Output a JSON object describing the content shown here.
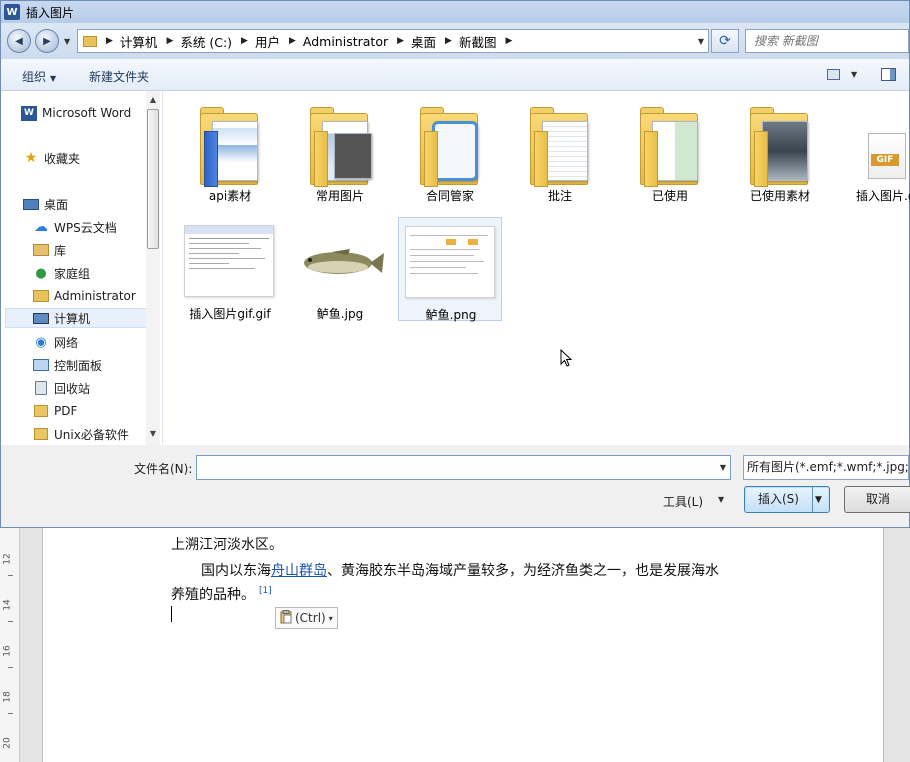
{
  "window": {
    "title": "插入图片",
    "app_icon_text": "W"
  },
  "nav": {
    "back_glyph": "◀",
    "forward_glyph": "▶",
    "breadcrumbs": [
      "计算机",
      "系统 (C:)",
      "用户",
      "Administrator",
      "桌面",
      "新截图"
    ],
    "breadcrumb_separator": "▶",
    "search_placeholder": "搜索 新截图",
    "refresh_glyph": "⟳"
  },
  "toolbar": {
    "organize_label": "组织",
    "new_folder_label": "新建文件夹"
  },
  "sidebar": {
    "items": [
      {
        "label": "Microsoft Word",
        "icon": "word-icon"
      },
      {
        "label": "收藏夹",
        "icon": "star-icon"
      },
      {
        "label": "桌面",
        "icon": "desktop-icon"
      },
      {
        "label": "WPS云文档",
        "icon": "cloud-icon"
      },
      {
        "label": "库",
        "icon": "library-icon"
      },
      {
        "label": "家庭组",
        "icon": "homegroup-icon"
      },
      {
        "label": "Administrator",
        "icon": "user-folder-icon"
      },
      {
        "label": "计算机",
        "icon": "computer-icon",
        "selected": true
      },
      {
        "label": "网络",
        "icon": "network-icon"
      },
      {
        "label": "控制面板",
        "icon": "control-panel-icon"
      },
      {
        "label": "回收站",
        "icon": "recycle-bin-icon"
      },
      {
        "label": "PDF",
        "icon": "folder-icon"
      },
      {
        "label": "Unix必备软件",
        "icon": "folder-icon"
      }
    ]
  },
  "files": [
    {
      "name": "api素材",
      "type": "folder"
    },
    {
      "name": "常用图片",
      "type": "folder"
    },
    {
      "name": "合同管家",
      "type": "folder"
    },
    {
      "name": "批注",
      "type": "folder"
    },
    {
      "name": "已使用",
      "type": "folder"
    },
    {
      "name": "已使用素材",
      "type": "folder"
    },
    {
      "name": "插入图片.gif",
      "type": "gif"
    },
    {
      "name": "插入图片gif.gif",
      "type": "image"
    },
    {
      "name": "鲈鱼.jpg",
      "type": "image"
    },
    {
      "name": "鲈鱼.png",
      "type": "image",
      "selected": true
    }
  ],
  "bottom": {
    "filename_label": "文件名(N):",
    "filename_value": "",
    "filter_value": "所有图片(*.emf;*.wmf;*.jpg;*.jpeg",
    "tools_label": "工具(L)",
    "insert_label": "插入(S)",
    "cancel_label": "取消"
  },
  "document": {
    "line1": "上溯江河淡水区。",
    "line2_prefix": "国内以东海",
    "line2_link": "舟山群岛",
    "line2_suffix": "、黄海胶东半岛海域产量较多，为经济鱼类之一，也是发展海水",
    "line3": "养殖的品种。",
    "footnote": "[1]",
    "paste_label": "(Ctrl)",
    "ruler_numbers": [
      "12",
      "14",
      "16",
      "18",
      "20"
    ]
  },
  "colors": {
    "accent": "#3c7fb1",
    "link": "#1a56b0",
    "folder": "#e7b941"
  }
}
